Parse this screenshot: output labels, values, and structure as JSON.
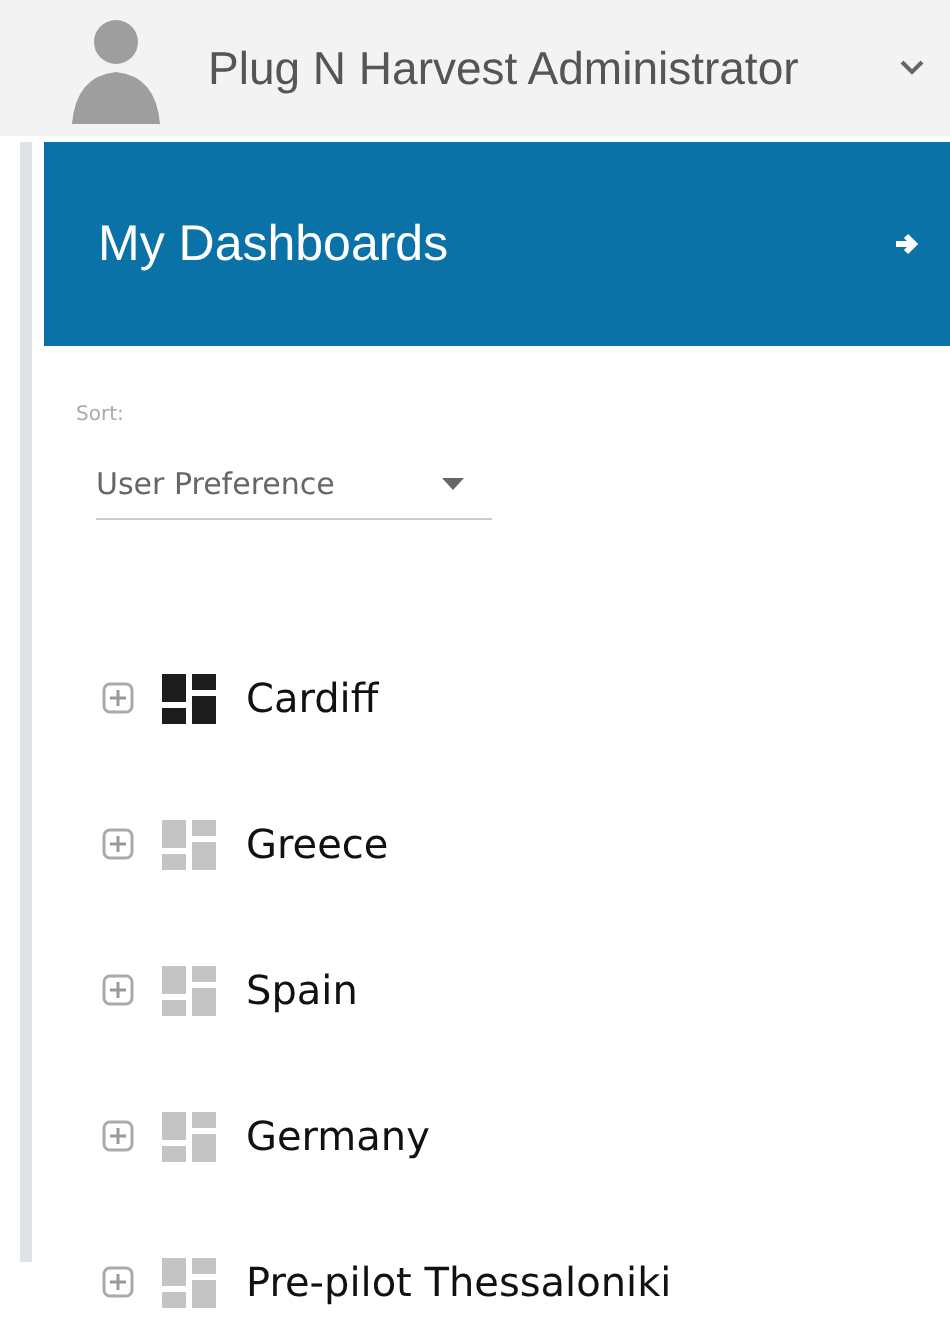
{
  "user": {
    "name": "Plug N Harvest Administrator"
  },
  "panel": {
    "title": "My Dashboards"
  },
  "sort": {
    "label": "Sort:",
    "value": "User Preference"
  },
  "dashboards": [
    {
      "name": "Cardiff",
      "selected": true
    },
    {
      "name": "Greece",
      "selected": false
    },
    {
      "name": "Spain",
      "selected": false
    },
    {
      "name": "Germany",
      "selected": false
    },
    {
      "name": "Pre-pilot Thessaloniki",
      "selected": false
    }
  ]
}
